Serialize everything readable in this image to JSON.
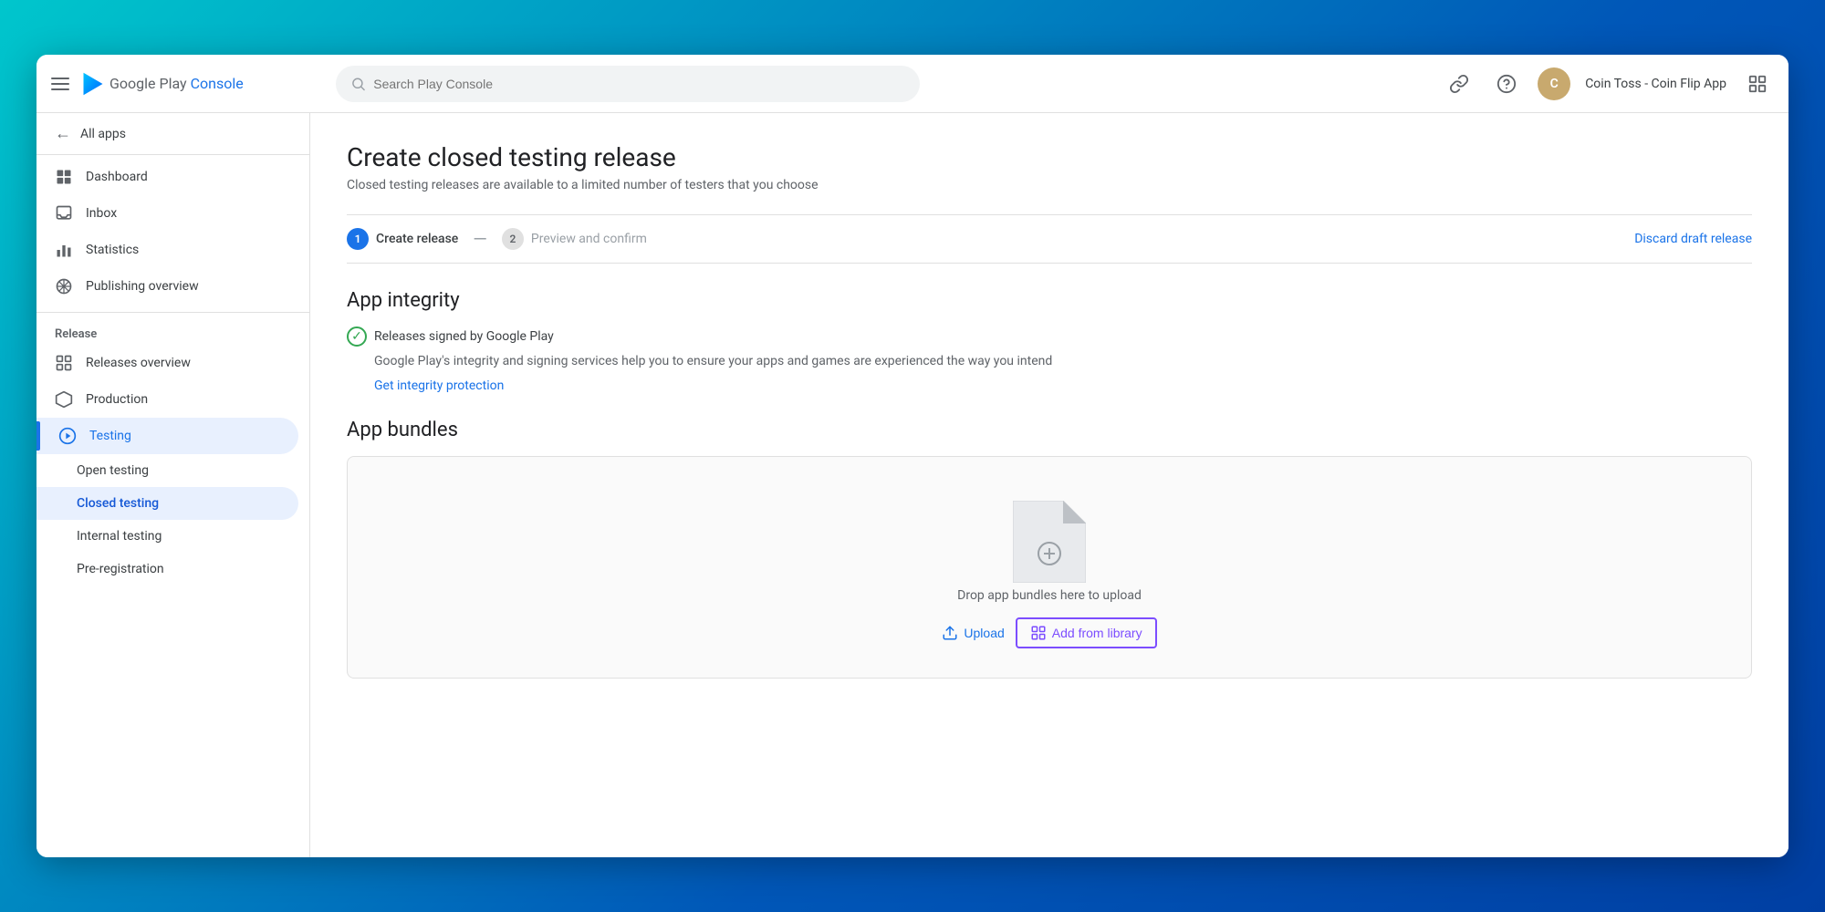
{
  "topbar": {
    "logo_text_regular": "Google Play",
    "logo_text_blue": "Console",
    "search_placeholder": "Search Play Console",
    "link_icon": "🔗",
    "help_icon": "?",
    "app_name": "Coin Toss - Coin Flip App"
  },
  "sidebar": {
    "all_apps": "All apps",
    "nav_items": [
      {
        "id": "dashboard",
        "label": "Dashboard",
        "icon": "⊞"
      },
      {
        "id": "inbox",
        "label": "Inbox",
        "icon": "□"
      },
      {
        "id": "statistics",
        "label": "Statistics",
        "icon": "▦"
      },
      {
        "id": "publishing-overview",
        "label": "Publishing overview",
        "icon": "⟳"
      }
    ],
    "release_section": "Release",
    "release_items": [
      {
        "id": "releases-overview",
        "label": "Releases overview",
        "icon": "⊞"
      },
      {
        "id": "production",
        "label": "Production",
        "icon": "🔔"
      },
      {
        "id": "testing",
        "label": "Testing",
        "icon": "▷",
        "active": true
      },
      {
        "id": "open-testing",
        "label": "Open testing",
        "sub": true
      },
      {
        "id": "closed-testing",
        "label": "Closed testing",
        "sub": true,
        "selected": true
      },
      {
        "id": "internal-testing",
        "label": "Internal testing",
        "sub": true
      },
      {
        "id": "pre-registration",
        "label": "Pre-registration",
        "sub": true
      }
    ]
  },
  "content": {
    "page_title": "Create closed testing release",
    "page_subtitle": "Closed testing releases are available to a limited number of testers that you choose",
    "steps": [
      {
        "number": "1",
        "label": "Create release",
        "active": true
      },
      {
        "number": "2",
        "label": "Preview and confirm",
        "active": false
      }
    ],
    "discard_label": "Discard draft release",
    "app_integrity_title": "App integrity",
    "integrity_check_label": "Releases signed by Google Play",
    "integrity_desc": "Google Play's integrity and signing services help you to ensure your apps and games are experienced the way you intend",
    "integrity_link": "Get integrity protection",
    "app_bundles_title": "App bundles",
    "drop_label": "Drop app bundles here to upload",
    "upload_label": "Upload",
    "add_library_label": "Add from library"
  }
}
